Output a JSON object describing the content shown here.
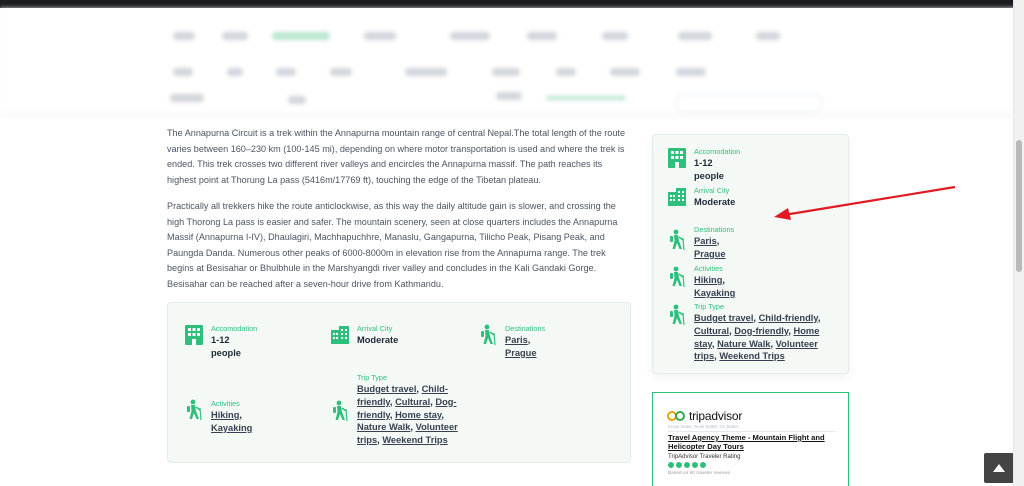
{
  "article": {
    "paragraph1": "The Annapurna Circuit is a trek within the Annapurna mountain range of central Nepal.The total length of the route varies between 160–230 km (100-145 mi), depending on where motor transportation is used and where the trek is ended. This trek crosses two different river valleys and encircles the Annapurna massif. The path reaches its highest point at Thorung La pass (5416m/17769 ft), touching the edge of the Tibetan plateau.",
    "paragraph2": "Practically all trekkers hike the route anticlockwise, as this way the daily altitude gain is slower, and crossing the high Thorong La pass is easier and safer. The mountain scenery, seen at close quarters includes the Annapurna Massif (Annapurna I-IV), Dhaulagiri, Machhapuchhre, Manaslu, Gangapurna, Tilicho Peak, Pisang Peak, and Paungda Danda. Numerous other peaks of 6000-8000m in elevation rise from the Annapurna range. The trek begins at Besisahar or Bhulbhule in the Marshyangdi river valley and concludes in the Kali Gandaki Gorge. Besisahar can be reached after a seven-hour drive from Kathmandu."
  },
  "features": {
    "accomodation_label": "Accomodation",
    "accomodation_value": "1-12 people",
    "arrival_label": "Arrival City",
    "arrival_value": "Moderate",
    "destinations_label": "Destinations",
    "destination_1": "Paris",
    "destination_2": "Prague",
    "activities_label": "Activities",
    "activity_1": "Hiking",
    "activity_2": "Kayaking",
    "trip_type_label": "Trip Type",
    "trip_1": "Budget travel",
    "trip_2": "Child-friendly",
    "trip_3": "Cultural",
    "trip_4": "Dog-friendly",
    "trip_5": "Home stay",
    "trip_6": "Nature Walk",
    "trip_7": "Volunteer trips",
    "trip_8": "Weekend Trips",
    "sep": ", "
  },
  "tripadvisor": {
    "logo_text": "tripadvisor",
    "tagline": "Know better. Book better. Go better.",
    "listing_name": "Travel Agency Theme - Mountain Flight and Helicopter Day Tours",
    "rating_label": "TripAdvisor Traveler Rating",
    "based_on": "Based on 60 traveler reviews",
    "rating": 5
  },
  "colors": {
    "accent": "#2fbf7d",
    "panel_bg": "#f4f9f6",
    "arrow": "#e01b24"
  },
  "icons": {
    "accomodation": "building-icon",
    "arrival": "city-icon",
    "destinations": "hiker-icon",
    "activities": "hiker-icon",
    "trip_type": "hiker-icon",
    "scroll_top": "chevron-up-icon"
  }
}
